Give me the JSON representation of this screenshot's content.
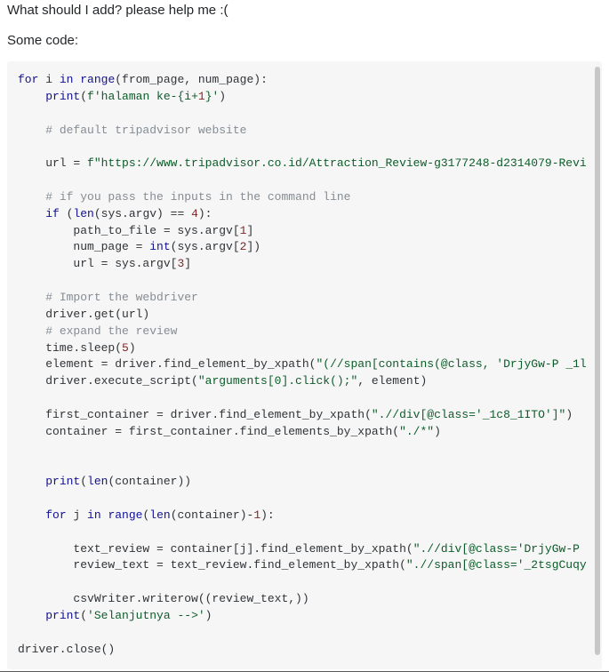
{
  "post": {
    "line1": "What should I add? please help me :(",
    "line2": "Some code:"
  },
  "code": {
    "l01a": "for",
    "l01b": " i ",
    "l01c": "in",
    "l01d": " ",
    "l01e": "range",
    "l01f": "(from_page, num_page):",
    "l02a": "    ",
    "l02b": "print",
    "l02c": "(",
    "l02d": "f'halaman ke-{i+",
    "l02e": "1",
    "l02f": "}'",
    "l02g": ")",
    "l03": " ",
    "l04a": "    ",
    "l04b": "# default tripadvisor website",
    "l05": " ",
    "l06a": "    url = ",
    "l06b": "f\"https://www.tripadvisor.co.id/Attraction_Review-g3177248-d2314079-Revi",
    "l07": " ",
    "l08a": "    ",
    "l08b": "# if you pass the inputs in the command line",
    "l09a": "    ",
    "l09b": "if",
    "l09c": " (",
    "l09d": "len",
    "l09e": "(sys.argv) == ",
    "l09f": "4",
    "l09g": "):",
    "l10a": "        path_to_file = sys.argv[",
    "l10b": "1",
    "l10c": "]",
    "l11a": "        num_page = ",
    "l11b": "int",
    "l11c": "(sys.argv[",
    "l11d": "2",
    "l11e": "])",
    "l12a": "        url = sys.argv[",
    "l12b": "3",
    "l12c": "]",
    "l13": " ",
    "l14a": "    ",
    "l14b": "# Import the webdriver",
    "l15": "    driver.get(url)",
    "l16a": "    ",
    "l16b": "# expand the review",
    "l17a": "    time.sleep(",
    "l17b": "5",
    "l17c": ")",
    "l18a": "    element = driver.find_element_by_xpath(",
    "l18b": "\"(//span[contains(@class, 'DrjyGw-P _1l",
    "l19a": "    driver.execute_script(",
    "l19b": "\"arguments[0].click();\"",
    "l19c": ", element)",
    "l20": " ",
    "l21a": "    first_container = driver.find_element_by_xpath(",
    "l21b": "\".//div[@class='_1c8_1ITO']\"",
    "l21c": ")",
    "l22a": "    container = first_container.find_elements_by_xpath(",
    "l22b": "\"./*\"",
    "l22c": ")",
    "l23": " ",
    "l24": " ",
    "l25a": "    ",
    "l25b": "print",
    "l25c": "(",
    "l25d": "len",
    "l25e": "(container))",
    "l26": " ",
    "l27a": "    ",
    "l27b": "for",
    "l27c": " j ",
    "l27d": "in",
    "l27e": " ",
    "l27f": "range",
    "l27g": "(",
    "l27h": "len",
    "l27i": "(container)-",
    "l27j": "1",
    "l27k": "):",
    "l28": " ",
    "l29a": "        text_review = container[j].find_element_by_xpath(",
    "l29b": "\".//div[@class='DrjyGw-P ",
    "l30a": "        review_text = text_review.find_element_by_xpath(",
    "l30b": "\".//span[@class='_2tsgCuqy",
    "l31": " ",
    "l32": "        csvWriter.writerow((review_text,))",
    "l33a": "    ",
    "l33b": "print",
    "l33c": "(",
    "l33d": "'Selanjutnya -->'",
    "l33e": ")",
    "l34": " ",
    "l35": "driver.close()"
  }
}
